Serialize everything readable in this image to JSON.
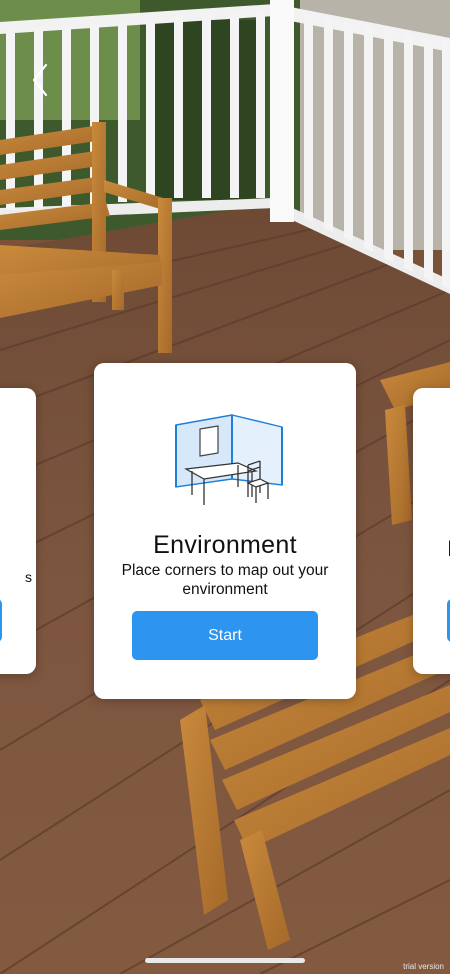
{
  "nav": {
    "back_icon": "chevron-left-icon"
  },
  "carousel": {
    "main_card": {
      "illustration_icon": "room-corner-table-chair-icon",
      "title": "Environment",
      "description": "Place corners to map out your environment",
      "button_label": "Start"
    },
    "left_card": {
      "visible_text_fragment": "s"
    },
    "right_card": {
      "visible_text_fragment": "I"
    }
  },
  "watermark": "trial version",
  "colors": {
    "accent": "#2d94f0",
    "card_bg": "#ffffff",
    "text": "#111111",
    "illustration_stroke": "#1f7fd6",
    "illustration_fill": "#d6e8fa"
  }
}
